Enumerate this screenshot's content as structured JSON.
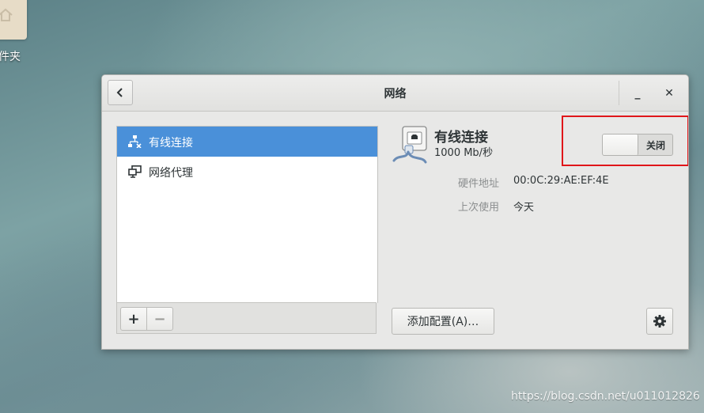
{
  "desktop": {
    "folder_label": "件夹",
    "watermark": "https://blog.csdn.net/u011012826"
  },
  "window": {
    "title": "网络",
    "minimize_glyph": "_",
    "close_glyph": "✕"
  },
  "sidebar": {
    "items": [
      {
        "label": "有线连接",
        "icon": "wired-network-icon",
        "selected": true
      },
      {
        "label": "网络代理",
        "icon": "network-proxy-icon",
        "selected": false
      }
    ],
    "add_label": "+",
    "remove_label": "−"
  },
  "device": {
    "icon": "ethernet-icon",
    "name": "有线连接",
    "speed": "1000 Mb/秒",
    "switch_label": "关闭",
    "switch_on": false
  },
  "properties": [
    {
      "key": "硬件地址",
      "value": "00:0C:29:AE:EF:4E"
    },
    {
      "key": "上次使用",
      "value": "今天"
    }
  ],
  "actions": {
    "add_profile_label": "添加配置(A)…",
    "settings_icon": "gear-icon"
  },
  "colors": {
    "selection": "#4a90d9",
    "highlight_box": "#e0161a"
  }
}
